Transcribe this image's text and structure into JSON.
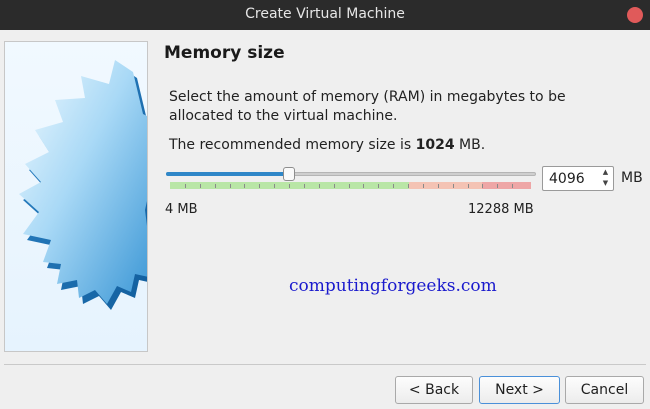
{
  "window": {
    "title": "Create Virtual Machine"
  },
  "page": {
    "heading": "Memory size",
    "description": "Select the amount of memory (RAM) in megabytes to be allocated to the virtual machine.",
    "recommended_prefix": "The recommended memory size is ",
    "recommended_value": "1024",
    "recommended_suffix": " MB."
  },
  "memory": {
    "min_label": "4 MB",
    "max_label": "12288 MB",
    "value": "4096",
    "unit": "MB",
    "slider_fraction": 0.3333,
    "colors": {
      "fill": "#2f87c8",
      "safe": "#b9e6a6",
      "warning": "#f4c3b4",
      "danger": "#eea6a6"
    }
  },
  "watermark": "computingforgeeks.com",
  "buttons": {
    "back": "< Back",
    "next": "Next >",
    "cancel": "Cancel"
  }
}
